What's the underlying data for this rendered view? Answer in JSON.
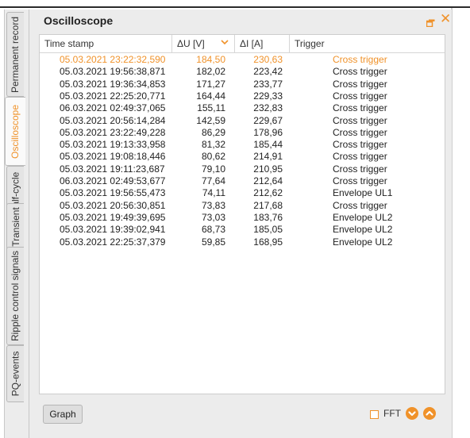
{
  "window": {
    "title": "Oscilloscope"
  },
  "tabs": [
    {
      "label": "Permanent record"
    },
    {
      "label": "Oscilloscope"
    },
    {
      "label": "Half-cycle"
    },
    {
      "label": "Transient"
    },
    {
      "label": "Ripple control signals"
    },
    {
      "label": "PQ-events"
    }
  ],
  "table": {
    "columns": [
      "Time stamp",
      "ΔU [V]",
      "ΔI [A]",
      "Trigger"
    ],
    "rows": [
      [
        "05.03.2021 23:22:32,590",
        "184,50",
        "230,63",
        "Cross trigger"
      ],
      [
        "05.03.2021 19:56:38,871",
        "182,02",
        "223,42",
        "Cross trigger"
      ],
      [
        "05.03.2021 19:36:34,853",
        "171,27",
        "233,77",
        "Cross trigger"
      ],
      [
        "05.03.2021 22:25:20,771",
        "164,44",
        "229,33",
        "Cross trigger"
      ],
      [
        "06.03.2021 02:49:37,065",
        "155,11",
        "232,83",
        "Cross trigger"
      ],
      [
        "05.03.2021 20:56:14,284",
        "142,59",
        "229,67",
        "Cross trigger"
      ],
      [
        "05.03.2021 23:22:49,228",
        "86,29",
        "178,96",
        "Cross trigger"
      ],
      [
        "05.03.2021 19:13:33,958",
        "81,32",
        "185,44",
        "Cross trigger"
      ],
      [
        "05.03.2021 19:08:18,446",
        "80,62",
        "214,91",
        "Cross trigger"
      ],
      [
        "05.03.2021 19:11:23,687",
        "79,10",
        "210,95",
        "Cross trigger"
      ],
      [
        "06.03.2021 02:49:53,677",
        "77,64",
        "212,64",
        "Cross trigger"
      ],
      [
        "05.03.2021 19:56:55,473",
        "74,11",
        "212,62",
        "Envelope UL1"
      ],
      [
        "05.03.2021 20:56:30,851",
        "73,83",
        "217,68",
        "Cross trigger"
      ],
      [
        "05.03.2021 19:49:39,695",
        "73,03",
        "183,76",
        "Envelope UL2"
      ],
      [
        "05.03.2021 19:39:02,941",
        "68,73",
        "185,05",
        "Envelope UL2"
      ],
      [
        "05.03.2021 22:25:37,379",
        "59,85",
        "168,95",
        "Envelope UL2"
      ]
    ]
  },
  "footer": {
    "graph_label": "Graph",
    "fft_label": "FFT"
  },
  "colors": {
    "accent": "#f0922a"
  }
}
